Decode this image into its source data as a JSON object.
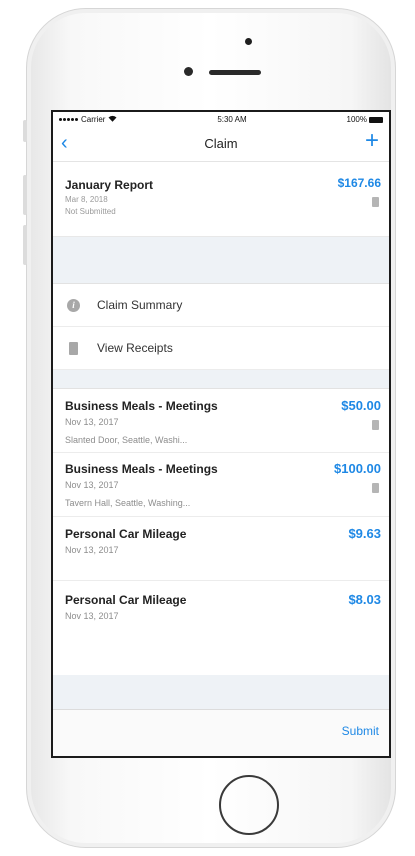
{
  "status_bar": {
    "carrier": "Carrier",
    "time": "5:30 AM",
    "battery": "100%"
  },
  "nav": {
    "title": "Claim",
    "back_icon": "chevron-left-icon",
    "add_icon": "plus-icon"
  },
  "report": {
    "name": "January Report",
    "date": "Mar 8, 2018",
    "status": "Not Submitted",
    "amount": "$167.66"
  },
  "menu": [
    {
      "label": "Claim Summary",
      "icon": "info-icon"
    },
    {
      "label": "View Receipts",
      "icon": "receipt-icon"
    }
  ],
  "items": [
    {
      "title": "Business Meals - Meetings",
      "date": "Nov 13, 2017",
      "location": "Slanted Door, Seattle, Washi...",
      "amount": "$50.00"
    },
    {
      "title": "Business Meals - Meetings",
      "date": "Nov 13, 2017",
      "location": "Tavern Hall, Seattle, Washing...",
      "amount": "$100.00"
    },
    {
      "title": "Personal Car Mileage",
      "date": "Nov 13, 2017",
      "amount": "$9.63"
    },
    {
      "title": "Personal Car Mileage",
      "date": "Nov 13, 2017",
      "amount": "$8.03"
    }
  ],
  "toolbar": {
    "submit_label": "Submit"
  },
  "colors": {
    "accent": "#1e88e5",
    "band": "#eef2f6"
  }
}
